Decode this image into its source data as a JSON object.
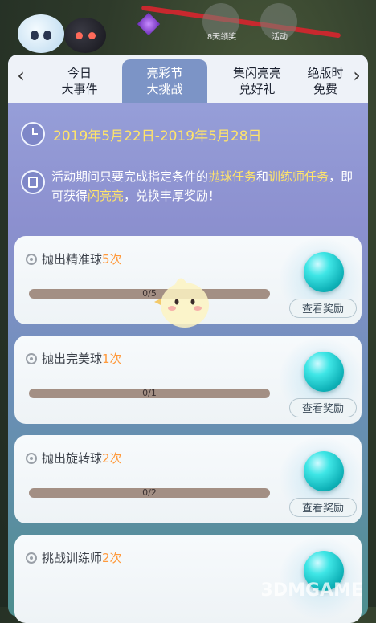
{
  "top_icons": [
    {
      "label": "8天领奖"
    },
    {
      "label": "活动"
    }
  ],
  "tabs": [
    {
      "line1": "今日",
      "line2": "大事件"
    },
    {
      "line1": "亮彩节",
      "line2": "大挑战"
    },
    {
      "line1": "集闪亮亮",
      "line2": "兑好礼"
    },
    {
      "line1": "绝版时",
      "line2": "免费"
    }
  ],
  "nav": {
    "prev": "‹",
    "next": "›"
  },
  "event": {
    "date_range": "2019年5月22日-2019年5月28日",
    "desc_part1": "活动期间只要完成指定条件的",
    "desc_hl1": "抛球任务",
    "desc_part2": "和",
    "desc_hl2": "训练师任务",
    "desc_part3": "，即可获得",
    "desc_hl3": "闪亮亮",
    "desc_part4": "，兑换丰厚奖励！"
  },
  "tasks": [
    {
      "name": "抛出精准球",
      "count": "5次",
      "progress": "0/5",
      "progress_fraction": 0,
      "button": "查看奖励"
    },
    {
      "name": "抛出完美球",
      "count": "1次",
      "progress": "0/1",
      "progress_fraction": 0,
      "button": "查看奖励"
    },
    {
      "name": "抛出旋转球",
      "count": "2次",
      "progress": "0/2",
      "progress_fraction": 0,
      "button": "查看奖励"
    },
    {
      "name": "挑战训练师",
      "count": "2次",
      "progress": "",
      "progress_fraction": 0,
      "button": ""
    }
  ],
  "watermark": "3DMGAME",
  "colors": {
    "highlight": "#ffe46a",
    "count": "#ff9a3c",
    "active_tab": "#7c94c6",
    "orb": "#3fe6e6"
  }
}
